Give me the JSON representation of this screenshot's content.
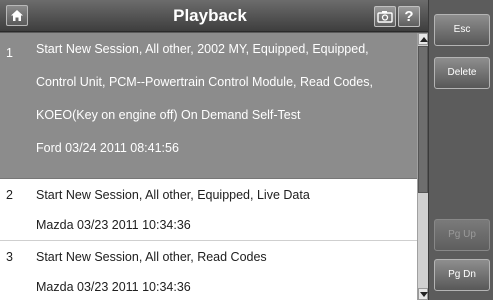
{
  "header": {
    "title": "Playback",
    "help_label": "?",
    "icons": {
      "home": "home-icon",
      "camera": "camera-icon"
    }
  },
  "sessions": [
    {
      "number": "1",
      "lines": [
        "Start New Session, All other, 2002 MY, Equipped, Equipped,",
        "Control Unit, PCM--Powertrain Control Module, Read Codes,",
        "KOEO(Key on engine off) On Demand Self-Test",
        "Ford 03/24 2011 08:41:56"
      ],
      "selected": true
    },
    {
      "number": "2",
      "lines": [
        "Start New Session, All other, Equipped, Live Data",
        "Mazda 03/23 2011 10:34:36"
      ],
      "selected": false
    },
    {
      "number": "3",
      "lines": [
        "Start New Session, All other, Read Codes",
        "Mazda 03/23 2011 10:34:36"
      ],
      "selected": false
    }
  ],
  "side_buttons": {
    "esc": "Esc",
    "delete": "Delete",
    "pg_up": "Pg Up",
    "pg_dn": "Pg Dn"
  },
  "colors": {
    "selected_row": "#8c8c8c",
    "panel": "#5c5c5c"
  }
}
